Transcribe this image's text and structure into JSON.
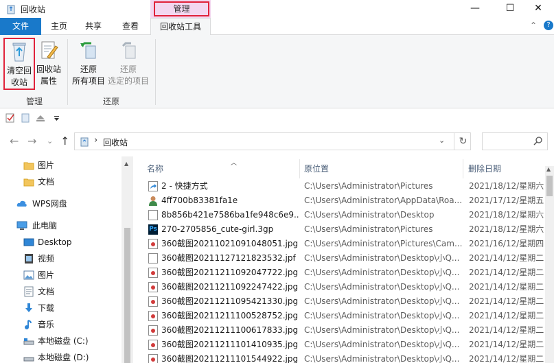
{
  "window": {
    "title": "回收站",
    "contextual_tab": "管理",
    "controls": {
      "minimize": "—",
      "maximize": "☐",
      "close": "✕"
    }
  },
  "tabs": {
    "file": "文件",
    "home": "主页",
    "share": "共享",
    "view": "查看",
    "recycle_tools": "回收站工具",
    "collapse": "⌃",
    "help": "?"
  },
  "ribbon": {
    "empty_bin_line1": "清空回",
    "empty_bin_line2": "收站",
    "properties_line1": "回收站",
    "properties_line2": "属性",
    "restore_all_line1": "还原",
    "restore_all_line2": "所有项目",
    "restore_selected_line1": "还原",
    "restore_selected_line2": "选定的项目",
    "group_manage": "管理",
    "group_restore": "还原"
  },
  "address": {
    "path": "回收站",
    "dropdown": "⌄",
    "refresh": "↻",
    "back": "←",
    "forward": "→",
    "recent": "⌄",
    "up": "↑"
  },
  "nav": {
    "items": [
      {
        "label": "图片",
        "icon": "folder-icon"
      },
      {
        "label": "文档",
        "icon": "folder-icon"
      },
      {
        "label": "WPS网盘",
        "icon": "cloud-icon"
      },
      {
        "label": "此电脑",
        "icon": "computer-icon"
      },
      {
        "label": "Desktop",
        "icon": "desktop-icon"
      },
      {
        "label": "视频",
        "icon": "video-icon"
      },
      {
        "label": "图片",
        "icon": "pictures-icon"
      },
      {
        "label": "文档",
        "icon": "documents-icon"
      },
      {
        "label": "下载",
        "icon": "download-icon"
      },
      {
        "label": "音乐",
        "icon": "music-icon"
      },
      {
        "label": "本地磁盘 (C:)",
        "icon": "drive-icon"
      },
      {
        "label": "本地磁盘 (D:)",
        "icon": "drive-icon"
      }
    ]
  },
  "columns": {
    "name": "名称",
    "location": "原位置",
    "date": "删除日期",
    "sort": "︿"
  },
  "files": [
    {
      "name": "2 - 快捷方式",
      "location": "C:\\Users\\Administrator\\Pictures",
      "date": "2021/18/12/星期六"
    },
    {
      "name": "4ff700b83381fa1e",
      "location": "C:\\Users\\Administrator\\AppData\\Roa...",
      "date": "2021/17/12/星期五"
    },
    {
      "name": "8b856b421e7586ba1fe948c6e9...",
      "location": "C:\\Users\\Administrator\\Desktop",
      "date": "2021/18/12/星期六"
    },
    {
      "name": "270-2705856_cute-girl.3gp",
      "location": "C:\\Users\\Administrator\\Pictures",
      "date": "2021/18/12/星期六"
    },
    {
      "name": "360截图20211021091048051.jpg",
      "location": "C:\\Users\\Administrator\\Pictures\\Cam...",
      "date": "2021/16/12/星期四"
    },
    {
      "name": "360截图20211127121823532.jpf",
      "location": "C:\\Users\\Administrator\\Desktop\\小Q...",
      "date": "2021/14/12/星期二"
    },
    {
      "name": "360截图20211211092047722.jpg",
      "location": "C:\\Users\\Administrator\\Desktop\\小Q...",
      "date": "2021/14/12/星期二"
    },
    {
      "name": "360截图20211211092247422.jpg",
      "location": "C:\\Users\\Administrator\\Desktop\\小Q...",
      "date": "2021/14/12/星期二"
    },
    {
      "name": "360截图20211211095421330.jpg",
      "location": "C:\\Users\\Administrator\\Desktop\\小Q...",
      "date": "2021/14/12/星期二"
    },
    {
      "name": "360截图20211211100528752.jpg",
      "location": "C:\\Users\\Administrator\\Desktop\\小Q...",
      "date": "2021/14/12/星期二"
    },
    {
      "name": "360截图20211211100617833.jpg",
      "location": "C:\\Users\\Administrator\\Desktop\\小Q...",
      "date": "2021/14/12/星期二"
    },
    {
      "name": "360截图20211211101410935.jpg",
      "location": "C:\\Users\\Administrator\\Desktop\\小Q...",
      "date": "2021/14/12/星期二"
    },
    {
      "name": "360截图20211211101544922.jpg",
      "location": "C:\\Users\\Administrator\\Desktop\\小Q...",
      "date": "2021/14/12/星期二"
    }
  ],
  "colors": {
    "accent": "#1979ca",
    "highlight": "#e0223a",
    "context_tab": "#f3d7f0"
  }
}
